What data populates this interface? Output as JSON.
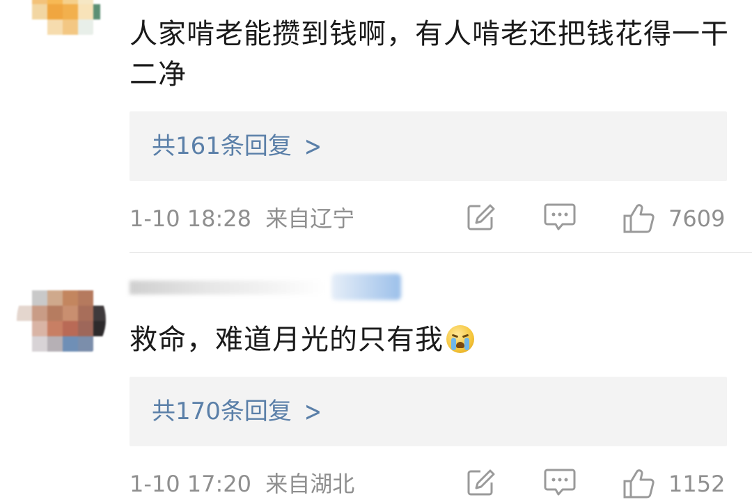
{
  "comments": [
    {
      "text": "人家啃老能攒到钱啊，有人啃老还把钱花得一干二净",
      "replies_label": "共161条回复",
      "time": "1-10 18:28",
      "location": "来自辽宁",
      "likes": "7609"
    },
    {
      "text": "救命，难道月光的只有我",
      "emoji": "crying-face-emoji",
      "replies_label": "共170条回复",
      "time": "1-10 17:20",
      "location": "来自湖北",
      "likes": "1152"
    }
  ],
  "icons": {
    "repost": "repost-icon",
    "comment": "comment-icon",
    "like": "thumbs-up-icon",
    "chevron": "chevron-right-icon"
  },
  "colors": {
    "link": "#5a7fa8",
    "meta": "#8f8f8f",
    "reply_bg": "#f3f3f3"
  }
}
